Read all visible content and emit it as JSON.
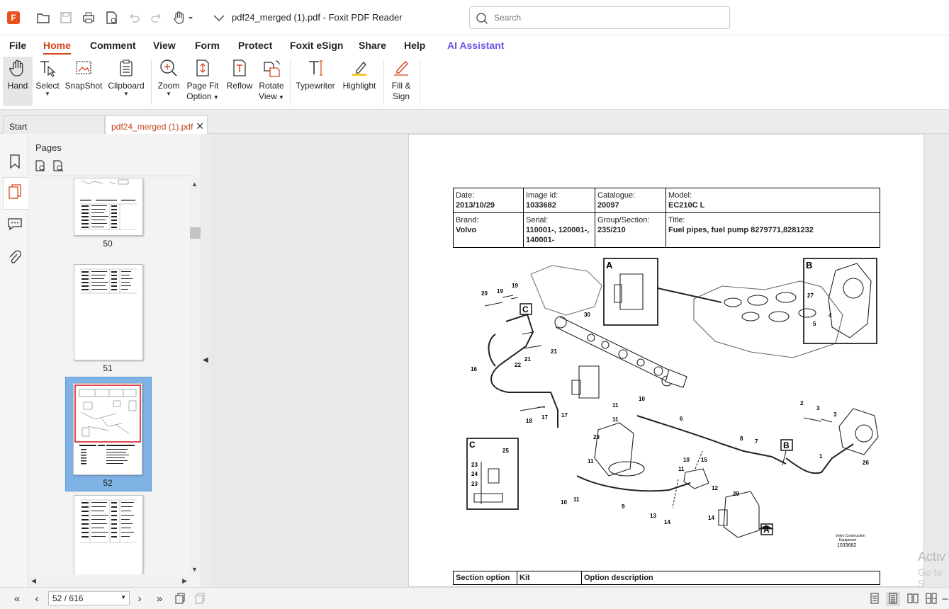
{
  "window": {
    "title": "pdf24_merged (1).pdf - Foxit PDF Reader",
    "search_placeholder": "Search"
  },
  "menu": [
    "File",
    "Home",
    "Comment",
    "View",
    "Form",
    "Protect",
    "Foxit eSign",
    "Share",
    "Help",
    "AI Assistant"
  ],
  "ribbon": {
    "hand": "Hand",
    "select": "Select",
    "snapshot": "SnapShot",
    "clipboard": "Clipboard",
    "zoom": "Zoom",
    "page_fit_1": "Page Fit",
    "page_fit_2": "Option",
    "reflow": "Reflow",
    "rotate_1": "Rotate",
    "rotate_2": "View",
    "typewriter": "Typewriter",
    "highlight": "Highlight",
    "fill_1": "Fill &",
    "fill_2": "Sign"
  },
  "tabs": {
    "start": "Start",
    "doc": "pdf24_merged (1).pdf"
  },
  "pages_panel": {
    "title": "Pages",
    "thumbs": [
      "50",
      "51",
      "52"
    ]
  },
  "document": {
    "date_label": "Date:",
    "date": "2013/10/29",
    "image_label": "Image id:",
    "image": "1033682",
    "catalogue_label": "Catalogue:",
    "catalogue": "20097",
    "model_label": "Model:",
    "model": "EC210C L",
    "brand_label": "Brand:",
    "brand": "Volvo",
    "serial_label": "Serial:",
    "serial": "110001-,  120001-, 140001-",
    "group_label": "Group/Section:",
    "group": "235/210",
    "title_label": "Title:",
    "title": "Fuel pipes, fuel pump 8279771,8281232",
    "opt_section": "Section option",
    "opt_kit": "Kit",
    "opt_desc": "Option description",
    "company_1": "Volvo Construction",
    "company_2": "Equipment",
    "drawing_id": "1033682"
  },
  "status": {
    "page": "52 / 616"
  },
  "watermark": {
    "line1": "Activ",
    "line2": "Go to S"
  }
}
